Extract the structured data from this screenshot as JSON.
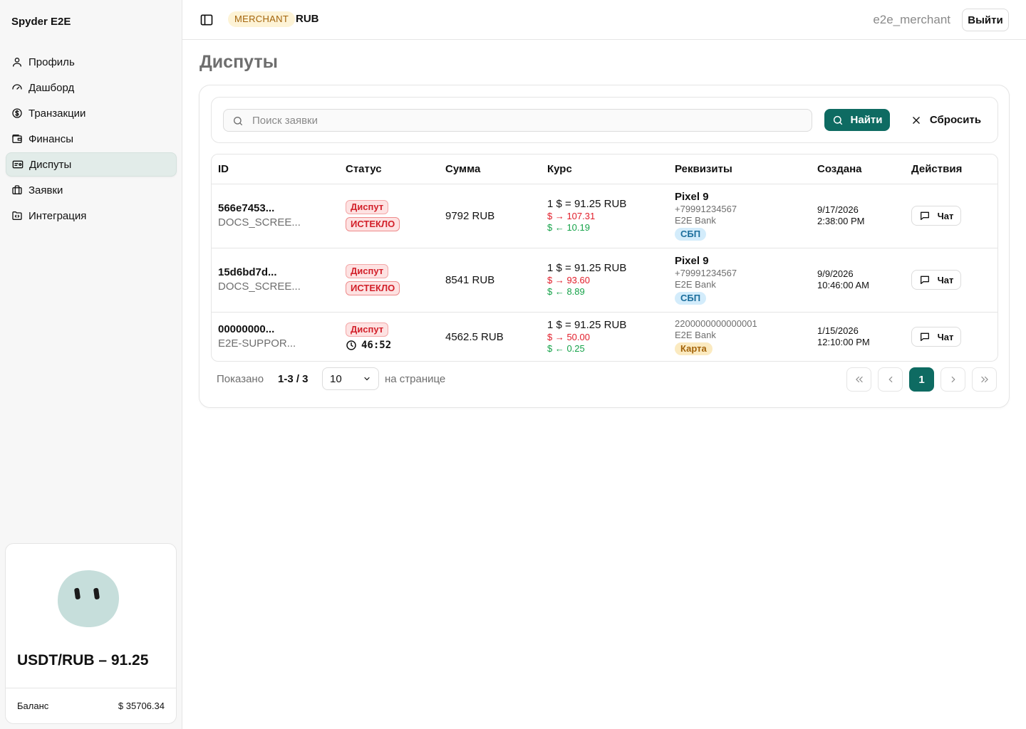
{
  "sidebar": {
    "brand": "Spyder E2E",
    "items": [
      {
        "label": "Профиль"
      },
      {
        "label": "Дашборд"
      },
      {
        "label": "Транзакции"
      },
      {
        "label": "Финансы"
      },
      {
        "label": "Диспуты"
      },
      {
        "label": "Заявки"
      },
      {
        "label": "Интеграция"
      }
    ],
    "rate_card": {
      "title": "USDT/RUB – 91.25",
      "balance_label": "Баланс",
      "balance_value": "$ 35706.34"
    }
  },
  "header": {
    "role": "MERCHANT",
    "currency": "RUB",
    "user": "e2e_merchant",
    "logout_label": "Выйти"
  },
  "main": {
    "title": "Диспуты",
    "search": {
      "placeholder": "Поиск заявки",
      "find_label": "Найти",
      "reset_label": "Сбросить"
    },
    "table": {
      "columns": [
        "ID",
        "Статус",
        "Сумма",
        "Курс",
        "Реквизиты",
        "Создана",
        "Действия"
      ],
      "rows": [
        {
          "id": "566e7453...",
          "ref": "DOCS_SCREE...",
          "status": "Диспут",
          "substatus": "ИСТЕКЛО",
          "amount": "9792 RUB",
          "rate": "1 $ = 91.25 RUB",
          "rate_out": "$ → 107.31",
          "rate_in": "$ ← 10.19",
          "req_title": "Pixel 9",
          "req_phone": "+79991234567",
          "req_bank": "E2E Bank",
          "req_tag": "СБП",
          "created_date": "9/17/2026",
          "created_time": "2:38:00 PM",
          "action": "Чат"
        },
        {
          "id": "15d6bd7d...",
          "ref": "DOCS_SCREE...",
          "status": "Диспут",
          "substatus": "ИСТЕКЛО",
          "amount": "8541 RUB",
          "rate": "1 $ = 91.25 RUB",
          "rate_out": "$ → 93.60",
          "rate_in": "$ ← 8.89",
          "req_title": "Pixel 9",
          "req_phone": "+79991234567",
          "req_bank": "E2E Bank",
          "req_tag": "СБП",
          "created_date": "9/9/2026",
          "created_time": "10:46:00 AM",
          "action": "Чат"
        },
        {
          "id": "00000000...",
          "ref": "E2E-SUPPOR...",
          "status": "Диспут",
          "timer": "46:52",
          "amount": "4562.5 RUB",
          "rate": "1 $ = 91.25 RUB",
          "rate_out": "$ → 50.00",
          "rate_in": "$ ← 0.25",
          "req_card": "2200000000000001",
          "req_bank": "E2E Bank",
          "req_tag": "Карта",
          "created_date": "1/15/2026",
          "created_time": "12:10:00 PM",
          "action": "Чат"
        }
      ]
    },
    "pagination": {
      "shown_label": "Показано",
      "range": "1-3 / 3",
      "page_size": "10",
      "per_page_label": "на странице",
      "current_page": "1"
    }
  },
  "colors": {
    "accent": "#0e6b62",
    "danger": "#e11d2a",
    "success": "#16a34a"
  }
}
